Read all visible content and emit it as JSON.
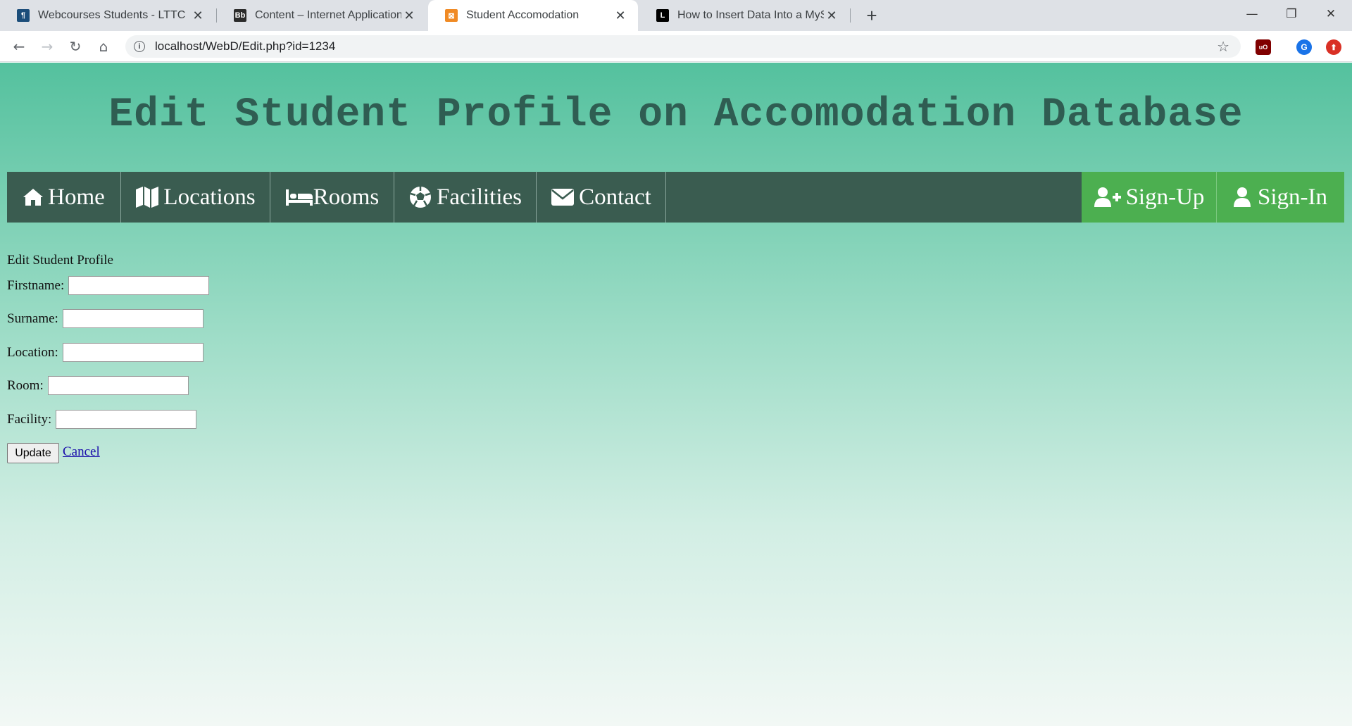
{
  "browser": {
    "tabs": [
      {
        "title": "Webcourses Students - LTTC",
        "icon": "webcourses-icon",
        "active": false
      },
      {
        "title": "Content – Internet Application ar",
        "icon": "blackboard-icon",
        "active": false
      },
      {
        "title": "Student Accomodation",
        "icon": "xampp-icon",
        "active": true
      },
      {
        "title": "How to Insert Data Into a MySQL",
        "icon": "lifewire-icon",
        "active": false
      }
    ],
    "new_tab": "+",
    "url": "localhost/WebD/Edit.php?id=1234",
    "window_controls": {
      "minimize": "—",
      "restore": "❐",
      "close": "✕"
    },
    "extensions": [
      "uBlock",
      "G"
    ]
  },
  "page": {
    "title": "Edit Student Profile on Accomodation Database",
    "nav": {
      "left": [
        {
          "label": "Home",
          "icon": "home-icon"
        },
        {
          "label": "Locations",
          "icon": "map-icon"
        },
        {
          "label": "Rooms",
          "icon": "bed-icon"
        },
        {
          "label": "Facilities",
          "icon": "soccer-ball-icon"
        },
        {
          "label": "Contact",
          "icon": "envelope-icon"
        }
      ],
      "right": [
        {
          "label": "Sign-Up",
          "icon": "user-plus-icon"
        },
        {
          "label": "Sign-In",
          "icon": "user-icon"
        }
      ]
    },
    "form": {
      "heading": "Edit Student Profile",
      "fields": [
        {
          "label": "Firstname:",
          "value": ""
        },
        {
          "label": "Surname:",
          "value": ""
        },
        {
          "label": "Location:",
          "value": ""
        },
        {
          "label": "Room:",
          "value": ""
        },
        {
          "label": "Facility:",
          "value": ""
        }
      ],
      "submit_label": "Update",
      "cancel_label": "Cancel"
    }
  },
  "colors": {
    "nav_bg": "#3a5c50",
    "auth_bg": "#4caf50",
    "title_color": "#2f5d52",
    "gradient_top": "#54c19e"
  }
}
